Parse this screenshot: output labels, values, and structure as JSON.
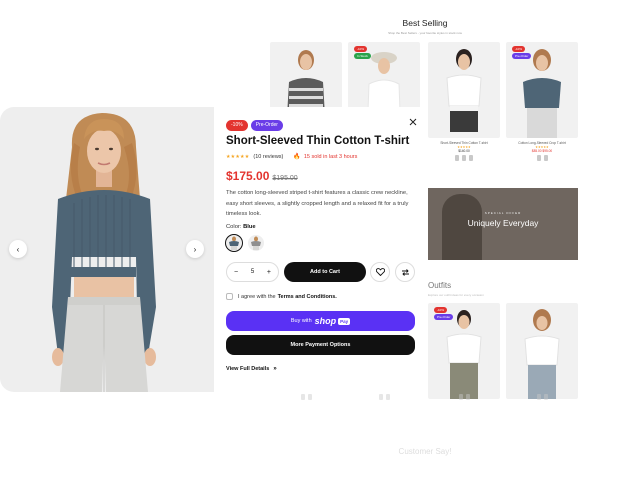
{
  "background": {
    "best_selling_title": "Best Selling",
    "best_selling_subtitle": "Shop the Best Sellers - your favorite styles in stock now",
    "grid_products": [
      {
        "badges": [],
        "name": "",
        "stars": "",
        "price": ""
      },
      {
        "badges": [
          {
            "label": "-10%",
            "color": "#e3342f"
          },
          {
            "label": "In Stock",
            "color": "#2aa34a"
          }
        ],
        "name": "",
        "stars": "",
        "price": ""
      },
      {
        "badges": [],
        "name": "Short-Sleeved Thin Cotton T-shirt",
        "stars": "★★★★★",
        "price": "$140.00"
      },
      {
        "badges": [
          {
            "label": "-10%",
            "color": "#e3342f"
          },
          {
            "label": "Pre-Order",
            "color": "#6a3de8"
          }
        ],
        "name": "Cotton Long-Sleeved Crop T-shirt",
        "stars": "★★★★★",
        "price": "$85.00 $95.00"
      }
    ],
    "promo": {
      "eyebrow": "SPECIAL OFFER",
      "title": "Uniquely Everyday"
    },
    "outfits_title": "Outfits",
    "outfits_subtitle": "Explore our outfit ideas for every occasion",
    "outfit_badges": [
      {
        "label": "-10%",
        "color": "#e3342f"
      },
      {
        "label": "Pre-Order",
        "color": "#6a3de8"
      }
    ],
    "customer_say": "Customer Say!"
  },
  "modal": {
    "badges": [
      {
        "label": "-10%",
        "color": "#e3342f"
      },
      {
        "label": "Pre-Order",
        "color": "#6a3de8"
      }
    ],
    "title": "Short-Sleeved Thin Cotton T-shirt",
    "stars": "★★★★★",
    "rating": 5,
    "reviews": "(10 reviews)",
    "sold": "15 sold in last 3 hours",
    "price": "$175.00",
    "old_price": "$195.00",
    "description": "The cotton long-sleeved striped t-shirt features a classic crew neckline, easy short sleeves, a slightly cropped length and a relaxed fit for a truly timeless look.",
    "color_label": "Color:",
    "color_value": "Blue",
    "swatches": [
      {
        "name": "Blue",
        "color": "#4e6576",
        "selected": true
      },
      {
        "name": "Gray",
        "color": "#8f8f8f",
        "selected": false
      }
    ],
    "quantity": "5",
    "qty_minus": "−",
    "qty_plus": "+",
    "add_to_cart": "Add to Cart",
    "terms_prefix": "I agree with the",
    "terms_link": "Terms and Conditions.",
    "buy_with": "Buy with",
    "shop": "shop",
    "pay": "Pay",
    "more_payment": "More Payment Options",
    "full_details": "View Full Details",
    "full_details_arrow": "»"
  },
  "image_panel": {
    "prev": "‹",
    "next": "›"
  },
  "colors": {
    "accent_red": "#e3342f",
    "accent_purple": "#6a3de8",
    "shop_pay": "#5a31f4"
  }
}
